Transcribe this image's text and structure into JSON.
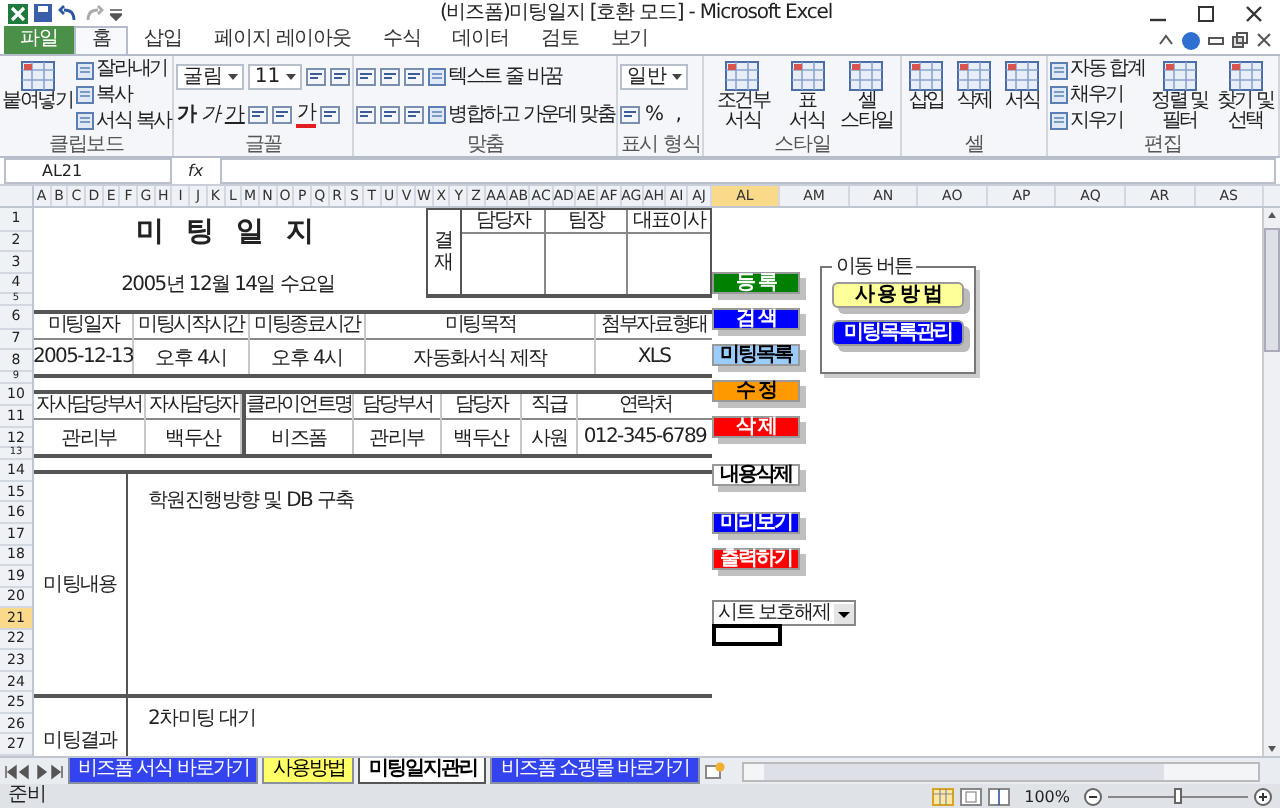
{
  "window": {
    "title": "(비즈폼)미팅일지 [호환 모드] - Microsoft Excel"
  },
  "ribbon_tabs": [
    {
      "label": "파일",
      "kind": "file",
      "selected": false
    },
    {
      "label": "홈",
      "kind": "tab",
      "selected": true
    },
    {
      "label": "삽입",
      "kind": "tab",
      "selected": false
    },
    {
      "label": "페이지 레이아웃",
      "kind": "tab",
      "selected": false
    },
    {
      "label": "수식",
      "kind": "tab",
      "selected": false
    },
    {
      "label": "데이터",
      "kind": "tab",
      "selected": false
    },
    {
      "label": "검토",
      "kind": "tab",
      "selected": false
    },
    {
      "label": "보기",
      "kind": "tab",
      "selected": false
    }
  ],
  "ribbon_groups": [
    {
      "label": "클립보드",
      "columns": [
        {
          "kind": "large",
          "label": "붙여넣기"
        },
        {
          "kind": "stack",
          "lines": [
            [
              {
                "kind": "button",
                "label": "잘라내기"
              }
            ],
            [
              {
                "kind": "button",
                "label": "복사"
              }
            ],
            [
              {
                "kind": "button",
                "label": "서식 복사"
              }
            ]
          ]
        }
      ]
    },
    {
      "label": "글꼴",
      "columns": [
        {
          "kind": "stack",
          "lines": [
            [
              {
                "kind": "field",
                "value": "굴림"
              },
              {
                "kind": "field",
                "value": "11"
              },
              {
                "kind": "icon"
              },
              {
                "kind": "icon"
              }
            ],
            [
              {
                "kind": "bold",
                "label": "가"
              },
              {
                "kind": "italic",
                "label": "가"
              },
              {
                "kind": "underline",
                "label": "가"
              },
              {
                "kind": "icon"
              },
              {
                "kind": "icon"
              },
              {
                "kind": "font-color",
                "label": "가"
              },
              {
                "kind": "icon"
              }
            ]
          ]
        }
      ]
    },
    {
      "label": "맞춤",
      "columns": [
        {
          "kind": "stack",
          "lines": [
            [
              {
                "kind": "icon"
              },
              {
                "kind": "icon"
              },
              {
                "kind": "icon"
              },
              {
                "kind": "button",
                "label": "텍스트 줄 바꿈"
              }
            ],
            [
              {
                "kind": "icon"
              },
              {
                "kind": "icon"
              },
              {
                "kind": "icon"
              },
              {
                "kind": "button",
                "label": "병합하고 가운데 맞춤"
              }
            ]
          ]
        }
      ]
    },
    {
      "label": "표시 형식",
      "columns": [
        {
          "kind": "stack",
          "lines": [
            [
              {
                "kind": "field",
                "value": "일반"
              }
            ],
            [
              {
                "kind": "icon"
              },
              {
                "kind": "glyph",
                "label": "%"
              },
              {
                "kind": "glyph",
                "label": ","
              }
            ]
          ]
        }
      ]
    },
    {
      "label": "스타일",
      "columns": [
        {
          "kind": "large",
          "label": "조건부 서식"
        },
        {
          "kind": "large",
          "label": "표 서식"
        },
        {
          "kind": "large",
          "label": "셀 스타일"
        }
      ]
    },
    {
      "label": "셀",
      "columns": [
        {
          "kind": "large",
          "label": "삽입"
        },
        {
          "kind": "large",
          "label": "삭제"
        },
        {
          "kind": "large",
          "label": "서식"
        }
      ]
    },
    {
      "label": "편집",
      "columns": [
        {
          "kind": "stack",
          "lines": [
            [
              {
                "kind": "button",
                "label": "자동 합계"
              }
            ],
            [
              {
                "kind": "button",
                "label": "채우기"
              }
            ],
            [
              {
                "kind": "button",
                "label": "지우기"
              }
            ]
          ]
        },
        {
          "kind": "large",
          "label": "정렬 및 필터"
        },
        {
          "kind": "large",
          "label": "찾기 및 선택"
        }
      ]
    }
  ],
  "formula_bar": {
    "name_box": "AL21",
    "function_label": "fx"
  },
  "columns": [
    {
      "label": "A",
      "selected": false
    },
    {
      "label": "B",
      "selected": false
    },
    {
      "label": "C",
      "selected": false
    },
    {
      "label": "D",
      "selected": false
    },
    {
      "label": "E",
      "selected": false
    },
    {
      "label": "F",
      "selected": false
    },
    {
      "label": "G",
      "selected": false
    },
    {
      "label": "H",
      "selected": false
    },
    {
      "label": "I",
      "selected": false
    },
    {
      "label": "J",
      "selected": false
    },
    {
      "label": "K",
      "selected": false
    },
    {
      "label": "L",
      "selected": false
    },
    {
      "label": "M",
      "selected": false
    },
    {
      "label": "N",
      "selected": false
    },
    {
      "label": "O",
      "selected": false
    },
    {
      "label": "P",
      "selected": false
    },
    {
      "label": "Q",
      "selected": false
    },
    {
      "label": "R",
      "selected": false
    },
    {
      "label": "S",
      "selected": false
    },
    {
      "label": "T",
      "selected": false
    },
    {
      "label": "U",
      "selected": false
    },
    {
      "label": "V",
      "selected": false
    },
    {
      "label": "W",
      "selected": false
    },
    {
      "label": "X",
      "selected": false
    },
    {
      "label": "Y",
      "selected": false
    },
    {
      "label": "Z",
      "selected": false
    },
    {
      "label": "AA",
      "selected": false
    },
    {
      "label": "AB",
      "selected": false
    },
    {
      "label": "AC",
      "selected": false
    },
    {
      "label": "AD",
      "selected": false
    },
    {
      "label": "AE",
      "selected": false
    },
    {
      "label": "AF",
      "selected": false
    },
    {
      "label": "AG",
      "selected": false
    },
    {
      "label": "AH",
      "selected": false
    },
    {
      "label": "AI",
      "selected": false
    },
    {
      "label": "AJ",
      "selected": false
    },
    {
      "label": "AL",
      "selected": true
    },
    {
      "label": "AM",
      "selected": false
    },
    {
      "label": "AN",
      "selected": false
    },
    {
      "label": "AO",
      "selected": false
    },
    {
      "label": "AP",
      "selected": false
    },
    {
      "label": "AQ",
      "selected": false
    },
    {
      "label": "AR",
      "selected": false
    },
    {
      "label": "AS",
      "selected": false
    }
  ],
  "rows": [
    {
      "label": "1",
      "selected": false
    },
    {
      "label": "2",
      "selected": false
    },
    {
      "label": "3",
      "selected": false
    },
    {
      "label": "4",
      "selected": false
    },
    {
      "label": "5",
      "selected": false
    },
    {
      "label": "6",
      "selected": false
    },
    {
      "label": "7",
      "selected": false
    },
    {
      "label": "8",
      "selected": false
    },
    {
      "label": "9",
      "selected": false
    },
    {
      "label": "10",
      "selected": false
    },
    {
      "label": "11",
      "selected": false
    },
    {
      "label": "12",
      "selected": false
    },
    {
      "label": "13",
      "selected": false
    },
    {
      "label": "14",
      "selected": false
    },
    {
      "label": "15",
      "selected": false
    },
    {
      "label": "16",
      "selected": false
    },
    {
      "label": "17",
      "selected": false
    },
    {
      "label": "18",
      "selected": false
    },
    {
      "label": "19",
      "selected": false
    },
    {
      "label": "20",
      "selected": false
    },
    {
      "label": "21",
      "selected": true
    },
    {
      "label": "22",
      "selected": false
    },
    {
      "label": "23",
      "selected": false
    },
    {
      "label": "24",
      "selected": false
    },
    {
      "label": "25",
      "selected": false
    },
    {
      "label": "26",
      "selected": false
    },
    {
      "label": "27",
      "selected": false
    }
  ],
  "form": {
    "title": "미 팅 일 지",
    "date": "2005년 12월 14일 수요일",
    "approval": {
      "label": "결재",
      "columns": [
        "담당자",
        "팀장",
        "대표이사"
      ]
    },
    "meeting_table": {
      "headers": [
        "미팅일자",
        "미팅시작시간",
        "미팅종료시간",
        "미팅목적",
        "첨부자료형태"
      ],
      "values": [
        "2005-12-13",
        "오후 4시",
        "오후 4시",
        "자동화서식 제작",
        "XLS"
      ]
    },
    "contact_table": {
      "headers": [
        "자사담당부서",
        "자사담당자",
        "클라이언트명",
        "담당부서",
        "담당자",
        "직급",
        "연락처"
      ],
      "values": [
        "관리부",
        "백두산",
        "비즈폼",
        "관리부",
        "백두산",
        "사원",
        "012-345-6789"
      ]
    },
    "sections": [
      {
        "label": "미팅내용",
        "text": "학원진행방향 및 DB 구축"
      },
      {
        "label": "미팅결과",
        "text": "2차미팅 대기"
      }
    ]
  },
  "buttons": [
    {
      "label": "등  록",
      "color": "#008000"
    },
    {
      "label": "검  색",
      "color": "#0000ff"
    },
    {
      "label": "미팅목록",
      "color": "#99ccff"
    },
    {
      "label": "수  정",
      "color": "#ff9900"
    },
    {
      "label": "삭  제",
      "color": "#ff0000"
    },
    {
      "label": "내용삭제",
      "color": "#ffffff"
    },
    {
      "label": "미리보기",
      "color": "#0000ff"
    },
    {
      "label": "출력하기",
      "color": "#ff0000"
    }
  ],
  "nav_group": {
    "title": "이동 버튼",
    "buttons": [
      {
        "label": "사 용 방 법",
        "color": "#ffff99"
      },
      {
        "label": "미팅목록관리",
        "color": "#0000ff"
      }
    ]
  },
  "sheet_combo": {
    "value": "시트 보호해제"
  },
  "sheet_tabs": [
    {
      "label": "비즈폼 서식 바로가기",
      "color": "#3344ee",
      "selected": false
    },
    {
      "label": "사용방법",
      "color": "#ffff66",
      "selected": false
    },
    {
      "label": "미팅일지관리",
      "color": "#ffffff",
      "selected": true
    },
    {
      "label": "비즈폼 쇼핑몰 바로가기",
      "color": "#3344ee",
      "selected": false
    }
  ],
  "status_bar": {
    "text": "준비",
    "zoom": "100%",
    "zoom_slider": {
      "level": 0.5
    }
  }
}
